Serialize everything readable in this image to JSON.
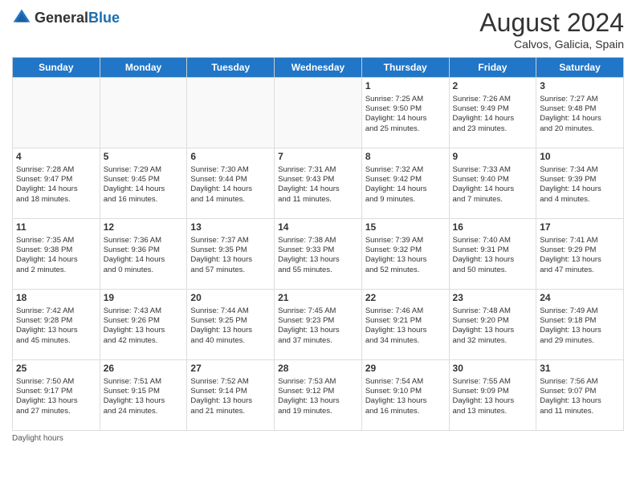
{
  "header": {
    "logo_general": "General",
    "logo_blue": "Blue",
    "month_year": "August 2024",
    "location": "Calvos, Galicia, Spain"
  },
  "weekdays": [
    "Sunday",
    "Monday",
    "Tuesday",
    "Wednesday",
    "Thursday",
    "Friday",
    "Saturday"
  ],
  "footer": {
    "daylight_hours": "Daylight hours"
  },
  "weeks": [
    [
      {
        "day": "",
        "info": ""
      },
      {
        "day": "",
        "info": ""
      },
      {
        "day": "",
        "info": ""
      },
      {
        "day": "",
        "info": ""
      },
      {
        "day": "1",
        "info": "Sunrise: 7:25 AM\nSunset: 9:50 PM\nDaylight: 14 hours\nand 25 minutes."
      },
      {
        "day": "2",
        "info": "Sunrise: 7:26 AM\nSunset: 9:49 PM\nDaylight: 14 hours\nand 23 minutes."
      },
      {
        "day": "3",
        "info": "Sunrise: 7:27 AM\nSunset: 9:48 PM\nDaylight: 14 hours\nand 20 minutes."
      }
    ],
    [
      {
        "day": "4",
        "info": "Sunrise: 7:28 AM\nSunset: 9:47 PM\nDaylight: 14 hours\nand 18 minutes."
      },
      {
        "day": "5",
        "info": "Sunrise: 7:29 AM\nSunset: 9:45 PM\nDaylight: 14 hours\nand 16 minutes."
      },
      {
        "day": "6",
        "info": "Sunrise: 7:30 AM\nSunset: 9:44 PM\nDaylight: 14 hours\nand 14 minutes."
      },
      {
        "day": "7",
        "info": "Sunrise: 7:31 AM\nSunset: 9:43 PM\nDaylight: 14 hours\nand 11 minutes."
      },
      {
        "day": "8",
        "info": "Sunrise: 7:32 AM\nSunset: 9:42 PM\nDaylight: 14 hours\nand 9 minutes."
      },
      {
        "day": "9",
        "info": "Sunrise: 7:33 AM\nSunset: 9:40 PM\nDaylight: 14 hours\nand 7 minutes."
      },
      {
        "day": "10",
        "info": "Sunrise: 7:34 AM\nSunset: 9:39 PM\nDaylight: 14 hours\nand 4 minutes."
      }
    ],
    [
      {
        "day": "11",
        "info": "Sunrise: 7:35 AM\nSunset: 9:38 PM\nDaylight: 14 hours\nand 2 minutes."
      },
      {
        "day": "12",
        "info": "Sunrise: 7:36 AM\nSunset: 9:36 PM\nDaylight: 14 hours\nand 0 minutes."
      },
      {
        "day": "13",
        "info": "Sunrise: 7:37 AM\nSunset: 9:35 PM\nDaylight: 13 hours\nand 57 minutes."
      },
      {
        "day": "14",
        "info": "Sunrise: 7:38 AM\nSunset: 9:33 PM\nDaylight: 13 hours\nand 55 minutes."
      },
      {
        "day": "15",
        "info": "Sunrise: 7:39 AM\nSunset: 9:32 PM\nDaylight: 13 hours\nand 52 minutes."
      },
      {
        "day": "16",
        "info": "Sunrise: 7:40 AM\nSunset: 9:31 PM\nDaylight: 13 hours\nand 50 minutes."
      },
      {
        "day": "17",
        "info": "Sunrise: 7:41 AM\nSunset: 9:29 PM\nDaylight: 13 hours\nand 47 minutes."
      }
    ],
    [
      {
        "day": "18",
        "info": "Sunrise: 7:42 AM\nSunset: 9:28 PM\nDaylight: 13 hours\nand 45 minutes."
      },
      {
        "day": "19",
        "info": "Sunrise: 7:43 AM\nSunset: 9:26 PM\nDaylight: 13 hours\nand 42 minutes."
      },
      {
        "day": "20",
        "info": "Sunrise: 7:44 AM\nSunset: 9:25 PM\nDaylight: 13 hours\nand 40 minutes."
      },
      {
        "day": "21",
        "info": "Sunrise: 7:45 AM\nSunset: 9:23 PM\nDaylight: 13 hours\nand 37 minutes."
      },
      {
        "day": "22",
        "info": "Sunrise: 7:46 AM\nSunset: 9:21 PM\nDaylight: 13 hours\nand 34 minutes."
      },
      {
        "day": "23",
        "info": "Sunrise: 7:48 AM\nSunset: 9:20 PM\nDaylight: 13 hours\nand 32 minutes."
      },
      {
        "day": "24",
        "info": "Sunrise: 7:49 AM\nSunset: 9:18 PM\nDaylight: 13 hours\nand 29 minutes."
      }
    ],
    [
      {
        "day": "25",
        "info": "Sunrise: 7:50 AM\nSunset: 9:17 PM\nDaylight: 13 hours\nand 27 minutes."
      },
      {
        "day": "26",
        "info": "Sunrise: 7:51 AM\nSunset: 9:15 PM\nDaylight: 13 hours\nand 24 minutes."
      },
      {
        "day": "27",
        "info": "Sunrise: 7:52 AM\nSunset: 9:14 PM\nDaylight: 13 hours\nand 21 minutes."
      },
      {
        "day": "28",
        "info": "Sunrise: 7:53 AM\nSunset: 9:12 PM\nDaylight: 13 hours\nand 19 minutes."
      },
      {
        "day": "29",
        "info": "Sunrise: 7:54 AM\nSunset: 9:10 PM\nDaylight: 13 hours\nand 16 minutes."
      },
      {
        "day": "30",
        "info": "Sunrise: 7:55 AM\nSunset: 9:09 PM\nDaylight: 13 hours\nand 13 minutes."
      },
      {
        "day": "31",
        "info": "Sunrise: 7:56 AM\nSunset: 9:07 PM\nDaylight: 13 hours\nand 11 minutes."
      }
    ]
  ]
}
